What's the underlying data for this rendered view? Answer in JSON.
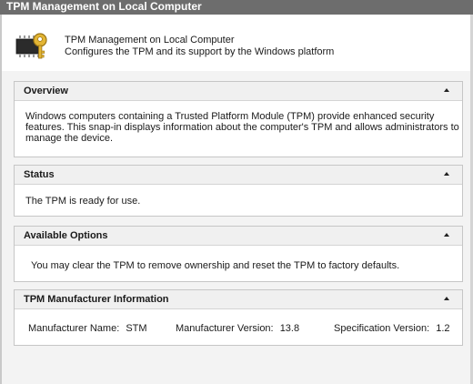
{
  "window": {
    "title": "TPM Management on Local Computer"
  },
  "header": {
    "icon": "tpm-chip-key-icon",
    "title": "TPM Management on Local Computer",
    "subtitle": "Configures the TPM and its support by the Windows platform"
  },
  "panels": {
    "overview": {
      "title": "Overview",
      "text": "Windows computers containing a Trusted Platform Module (TPM) provide enhanced security features. This snap-in displays information about the computer's TPM and allows administrators to manage the device."
    },
    "status": {
      "title": "Status",
      "text": "The TPM is ready for use."
    },
    "options": {
      "title": "Available Options",
      "text": "You may clear the TPM to remove ownership and reset the TPM to factory defaults."
    },
    "manufacturer": {
      "title": "TPM Manufacturer Information",
      "name_label": "Manufacturer Name:",
      "name_value": "STM",
      "version_label": "Manufacturer Version:",
      "version_value": "13.8",
      "spec_label": "Specification Version:",
      "spec_value": "1.2"
    }
  },
  "icons": {
    "collapse": "collapse-arrow-icon"
  }
}
